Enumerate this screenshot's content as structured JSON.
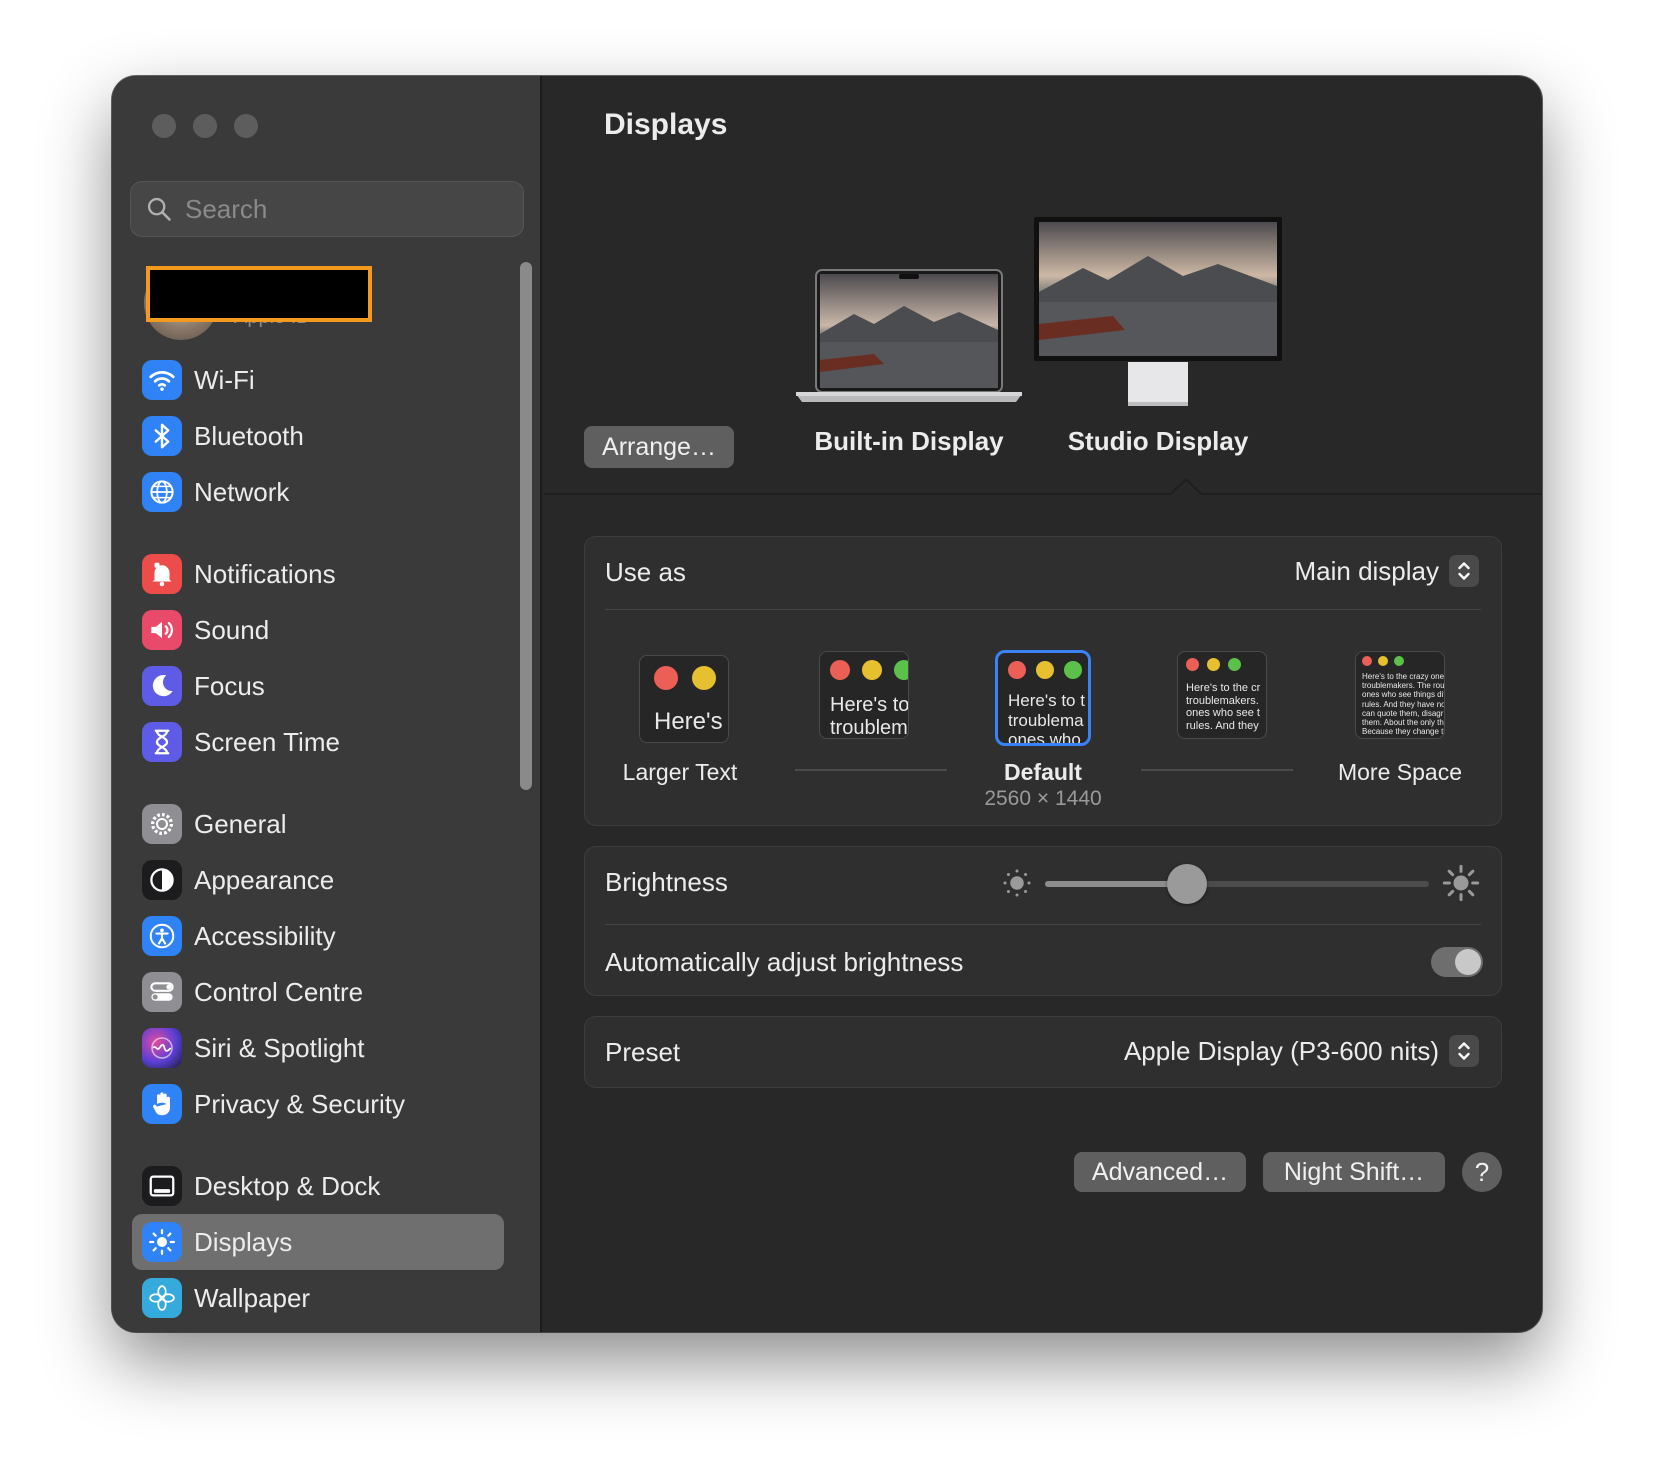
{
  "sidebar": {
    "search_placeholder": "Search",
    "profile_sub": "Apple ID",
    "items": [
      {
        "label": "Wi-Fi",
        "icon": "wifi-icon",
        "color": "#2f83f6"
      },
      {
        "label": "Bluetooth",
        "icon": "bluetooth-icon",
        "color": "#2f83f6"
      },
      {
        "label": "Network",
        "icon": "globe-icon",
        "color": "#2f83f6"
      },
      {
        "label": "Notifications",
        "icon": "bell-icon",
        "color": "#ec4d4a"
      },
      {
        "label": "Sound",
        "icon": "speaker-icon",
        "color": "#ea4a6a"
      },
      {
        "label": "Focus",
        "icon": "moon-icon",
        "color": "#5e5ce6"
      },
      {
        "label": "Screen Time",
        "icon": "hourglass-icon",
        "color": "#5e5ce6"
      },
      {
        "label": "General",
        "icon": "gear-icon",
        "color": "#8e8e93"
      },
      {
        "label": "Appearance",
        "icon": "appearance-icon",
        "color": "#1c1c1e"
      },
      {
        "label": "Accessibility",
        "icon": "accessibility-icon",
        "color": "#2f83f6"
      },
      {
        "label": "Control Centre",
        "icon": "control-centre-icon",
        "color": "#8e8e93"
      },
      {
        "label": "Siri & Spotlight",
        "icon": "siri-icon",
        "color": "#3a2d6b"
      },
      {
        "label": "Privacy & Security",
        "icon": "hand-icon",
        "color": "#2f83f6"
      },
      {
        "label": "Desktop & Dock",
        "icon": "dock-icon",
        "color": "#1c1c1e"
      },
      {
        "label": "Displays",
        "icon": "sun-icon",
        "color": "#2f83f6"
      },
      {
        "label": "Wallpaper",
        "icon": "flower-icon",
        "color": "#35aadc"
      }
    ],
    "active": "Displays"
  },
  "main": {
    "title": "Displays",
    "arrange_label": "Arrange…",
    "displays": [
      {
        "name": "Built-in Display"
      },
      {
        "name": "Studio Display",
        "selected": true
      }
    ],
    "use_as": {
      "label": "Use as",
      "value": "Main display"
    },
    "resolution": {
      "options": [
        {
          "label": "Larger Text",
          "sample": "Here's"
        },
        {
          "label": "",
          "sample": "Here's to\ntroublem"
        },
        {
          "label": "Default",
          "sub": "2560 × 1440",
          "sample": "Here's to t\ntroublema\nones who",
          "selected": true
        },
        {
          "label": "",
          "sample": "Here's to the cr\ntroublemakers.\nones who see t\nrules. And they"
        },
        {
          "label": "More Space",
          "sample": "Here's to the crazy one\ntroublemakers. The rou\nones who see things dif\nrules. And they have no\ncan quote them, disagr\nthem. About the only th\nBecause they change th"
        }
      ]
    },
    "brightness": {
      "label": "Brightness",
      "level": 0.37
    },
    "auto_brightness": {
      "label": "Automatically adjust brightness",
      "on": true
    },
    "preset": {
      "label": "Preset",
      "value": "Apple Display (P3-600 nits)"
    },
    "buttons": {
      "advanced": "Advanced…",
      "night_shift": "Night Shift…",
      "help": "?"
    }
  }
}
